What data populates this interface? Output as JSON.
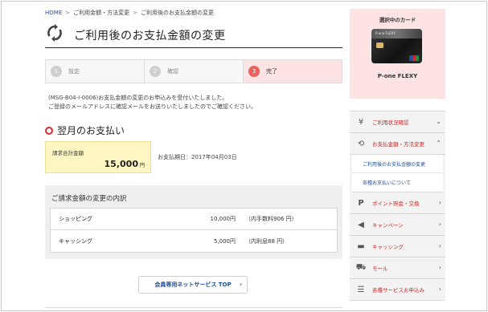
{
  "breadcrumb": {
    "home": "HOME",
    "items": [
      "ご利用金額・方法変更",
      "ご利用後のお支払金額の変更"
    ],
    "separator": ">"
  },
  "page": {
    "title": "ご利用後のお支払金額の変更",
    "title_icon": "refresh-arrows-icon"
  },
  "steps": [
    {
      "num": "1",
      "label": "設定",
      "active": false
    },
    {
      "num": "2",
      "label": "確認",
      "active": false
    },
    {
      "num": "3",
      "label": "完了",
      "active": true
    }
  ],
  "message": {
    "line1": "(MSG-B04-I-0006)お支払金額の変更のお申込みを受付いたしました。",
    "line2": "ご登録のメールアドレスに確認メールをお送りいたしましたのでご確認ください。"
  },
  "next_payment": {
    "heading": "翌月のお支払い",
    "total_label": "請求合計金額",
    "total_amount": "15,000",
    "total_unit": "円",
    "pay_date": "お支払期日：2017年04月03日"
  },
  "breakdown": {
    "title": "ご請求金額の変更の内訳",
    "rows": [
      {
        "name": "ショッピング",
        "amount": "10,000円",
        "note": "（内手数料906 円）"
      },
      {
        "name": "キャッシング",
        "amount": "5,000円",
        "note": "（内利息88 円）"
      }
    ]
  },
  "top_button": {
    "label": "会員専用ネットサービス TOP",
    "chevron": "›"
  },
  "card_panel": {
    "title": "選択中のカード",
    "card_name": "P-one FLEXY",
    "card_brand_text": "P-one FLEXY"
  },
  "side_nav": {
    "items": [
      {
        "label": "ご利用状況確認",
        "icon": "yen-icon",
        "chevron": "⌄"
      },
      {
        "label": "お支払金額・方法変更",
        "icon": "refresh-icon",
        "chevron": "⌃"
      },
      {
        "label": "ポイント照会・交換",
        "icon": "point-icon",
        "chevron": "›"
      },
      {
        "label": "キャンペーン",
        "icon": "megaphone-icon",
        "chevron": "›"
      },
      {
        "label": "キャッシング",
        "icon": "card-icon",
        "chevron": "›"
      },
      {
        "label": "モール",
        "icon": "cart-icon",
        "chevron": "›"
      },
      {
        "label": "各種サービスお申込み",
        "icon": "list-icon",
        "chevron": "›"
      }
    ],
    "sub_items": [
      "ご利用後のお支払金額の変更",
      "各種お支払いについて"
    ]
  },
  "colors": {
    "accent_red": "#c82a2a",
    "active_step_bg": "#fde3e4",
    "total_bg": "#fdf6c3",
    "link_blue": "#1a4f99"
  }
}
